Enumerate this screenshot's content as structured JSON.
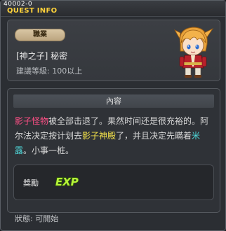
{
  "window": {
    "quest_id": "40002-0",
    "title": "QUEST INFO"
  },
  "quest": {
    "job_label": "職業",
    "name": "[神之子] 秘密",
    "required_level": "建議等級: 100以上"
  },
  "content": {
    "header": "內容",
    "description": [
      {
        "text": "影子怪物",
        "style": "red"
      },
      {
        "text": "被全部击退了。果然时间还是很充裕的。阿尔法决定按计划去",
        "style": "normal"
      },
      {
        "text": "影子神殿",
        "style": "yellow"
      },
      {
        "text": "了，并且决定先瞞着",
        "style": "normal"
      },
      {
        "text": "米露",
        "style": "cyan"
      },
      {
        "text": "。小事一桩。",
        "style": "normal"
      }
    ]
  },
  "reward": {
    "label": "獎勵",
    "icon": "exp-icon",
    "icon_text": "EXP"
  },
  "status": {
    "text": "狀態:  可開始"
  },
  "colors": {
    "title": "#ffd23a",
    "highlight_red": "#ff4f86",
    "highlight_yellow": "#f3e14a",
    "highlight_cyan": "#4fd7d9",
    "exp_green": "#b6f23a"
  }
}
